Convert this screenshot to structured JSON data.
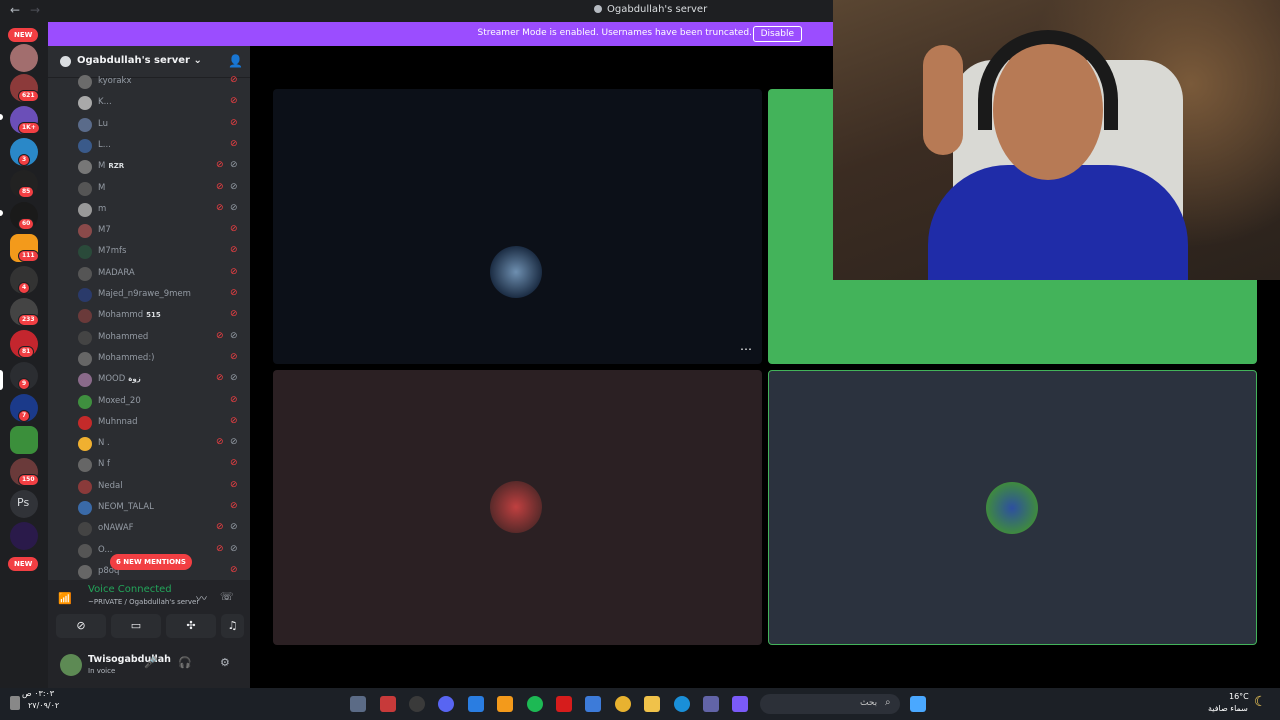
{
  "window": {
    "title": "Ogabdullah's server"
  },
  "banner": {
    "message": "Streamer Mode is enabled. Usernames have been truncated.",
    "button": "Disable"
  },
  "servers": {
    "new_top": "NEW",
    "new_bottom": "NEW",
    "badges": [
      "621",
      "1K+",
      "3",
      "85",
      "60",
      "111",
      "4",
      "233",
      "81",
      "9",
      "7",
      "150"
    ],
    "ps_label": "Ps"
  },
  "server_header": {
    "name": "Ogabdullah's server"
  },
  "members": [
    {
      "name": "kyorakx"
    },
    {
      "name": "K..."
    },
    {
      "name": "Lu"
    },
    {
      "name": "L..."
    },
    {
      "name": "M",
      "tag": "RZR"
    },
    {
      "name": "M"
    },
    {
      "name": "m"
    },
    {
      "name": "M7"
    },
    {
      "name": "M7mfs"
    },
    {
      "name": "MADARA"
    },
    {
      "name": "Majed_n9rawe_9mem"
    },
    {
      "name": "Mohammd",
      "tag": "515"
    },
    {
      "name": "Mohammed"
    },
    {
      "name": "Mohammed:)"
    },
    {
      "name": "MOOD",
      "tag": "زوة"
    },
    {
      "name": "Moxed_20"
    },
    {
      "name": "Muhnnad"
    },
    {
      "name": "N ."
    },
    {
      "name": "N f"
    },
    {
      "name": "Nedal"
    },
    {
      "name": "NEOM_TALAL"
    },
    {
      "name": "oNAWAF"
    },
    {
      "name": "O..."
    },
    {
      "name": "p8oq"
    }
  ],
  "mentions": "6 NEW MENTIONS",
  "voice": {
    "title": "Voice Connected",
    "subtitle": "~PRIVATE / Ogabdullah's server"
  },
  "user": {
    "name": "Twisogabdullah",
    "status": "In voice"
  },
  "taskbar": {
    "time": "٠٣:٠٣ ص",
    "date": "٢٧/٠٩/٠٢",
    "search": "بحث",
    "temperature": "16°C",
    "condition": "سماء صافية"
  },
  "colors": {
    "accent": "#9b4dff",
    "green_tile": "#43b35a",
    "mute_red": "#f23f43",
    "connected_green": "#23a55a"
  }
}
